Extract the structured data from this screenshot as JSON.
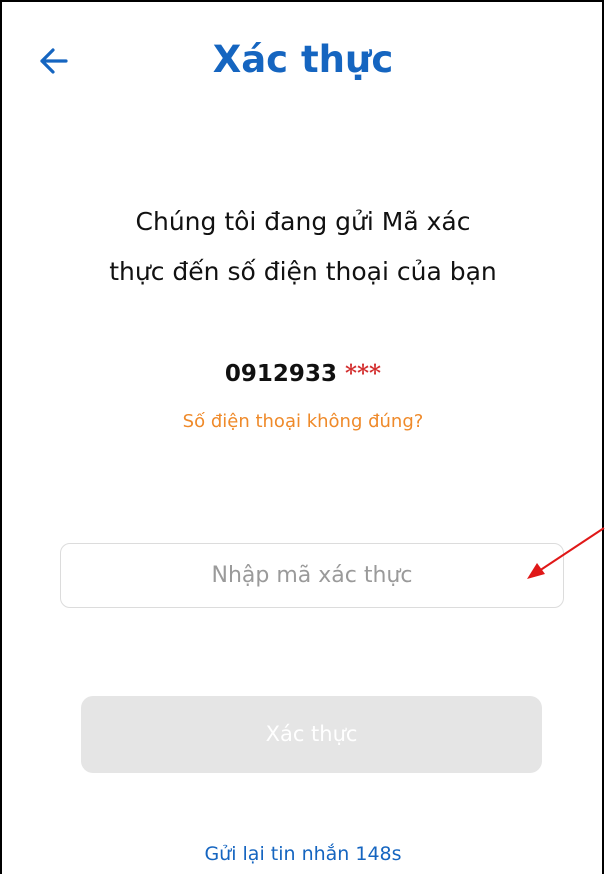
{
  "header": {
    "title": "Xác thực",
    "back_icon": "back-arrow-icon"
  },
  "message": {
    "line1": "Chúng tôi đang gửi Mã xác",
    "line2": "thực đến số điện thoại của bạn"
  },
  "phone": {
    "number": "0912933",
    "mask": "***"
  },
  "wrong_number_link": "Số điện thoại không đúng?",
  "verification": {
    "placeholder": "Nhập mã xác thực",
    "value": ""
  },
  "submit_button": {
    "label": "Xác thực",
    "enabled": false
  },
  "resend": {
    "label": "Gửi lại tin nhắn 148s"
  },
  "colors": {
    "primary": "#1565c0",
    "link_orange": "#ef8a2a",
    "mask_red": "#d32f2f",
    "disabled_button": "#e5e5e5",
    "annotation_arrow": "#e01818"
  }
}
